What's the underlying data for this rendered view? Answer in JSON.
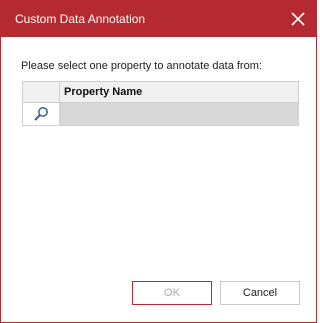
{
  "dialog": {
    "title": "Custom Data Annotation",
    "prompt": "Please select one property to annotate data from:"
  },
  "grid": {
    "columns": [
      "Property Name"
    ],
    "filter_icon": "search-icon",
    "rows": []
  },
  "buttons": {
    "ok_label": "OK",
    "cancel_label": "Cancel"
  },
  "colors": {
    "accent": "#b52a30",
    "header_bg": "#f0f0f0",
    "filter_bg": "#d8d8d8"
  }
}
